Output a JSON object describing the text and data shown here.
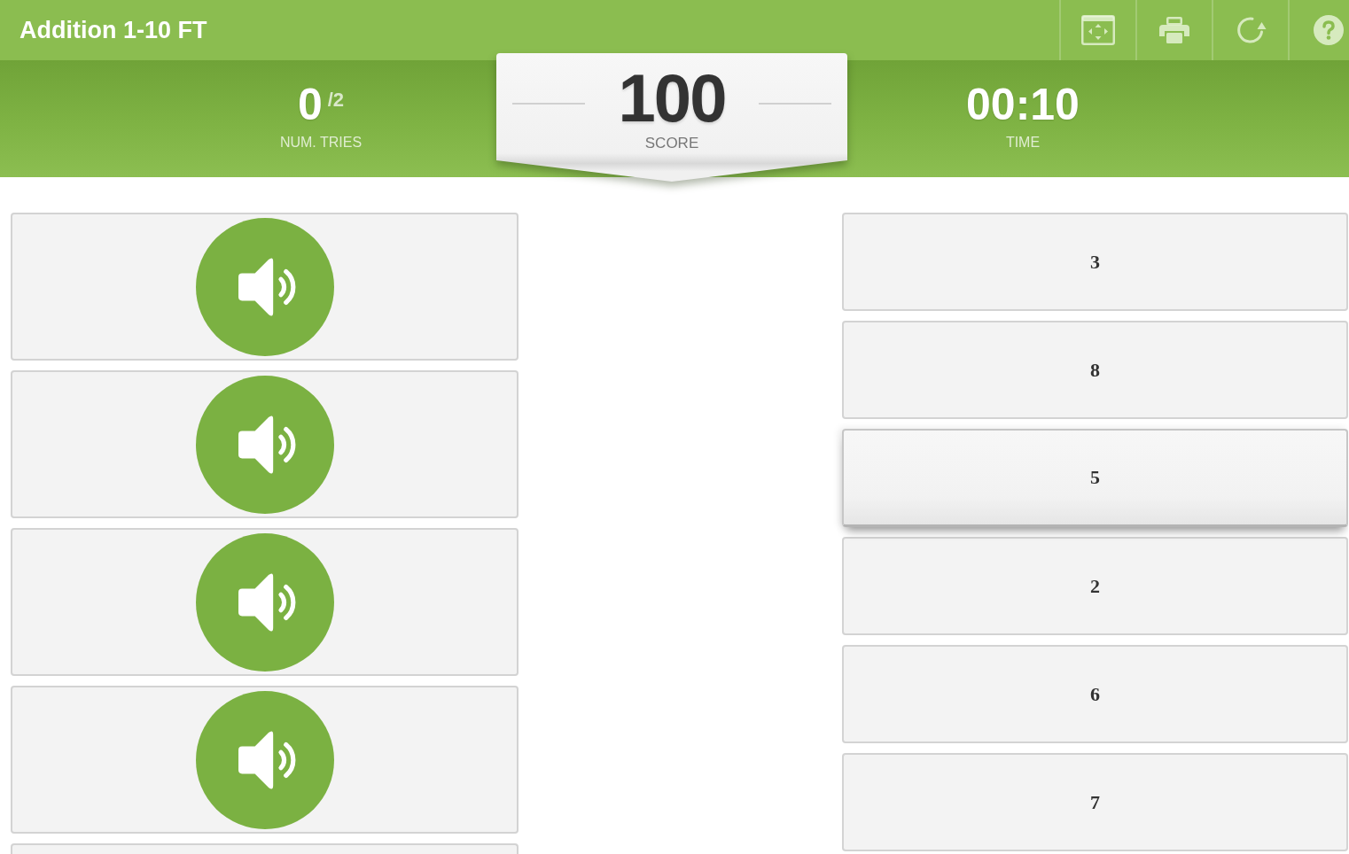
{
  "header": {
    "title": "Addition 1-10 FT"
  },
  "stats": {
    "tries": {
      "value": "0",
      "max": "/2",
      "label": "NUM. TRIES"
    },
    "score": {
      "value": "100",
      "label": "SCORE"
    },
    "time": {
      "value": "00:10",
      "label": "TIME"
    }
  },
  "left_cards": [
    {
      "kind": "audio"
    },
    {
      "kind": "audio"
    },
    {
      "kind": "audio"
    },
    {
      "kind": "audio"
    },
    {
      "kind": "empty"
    }
  ],
  "right_cards": [
    {
      "text": "3",
      "raised": false
    },
    {
      "text": "8",
      "raised": false
    },
    {
      "text": "5",
      "raised": true
    },
    {
      "text": "2",
      "raised": false
    },
    {
      "text": "6",
      "raised": false
    },
    {
      "text": "7",
      "raised": false
    }
  ]
}
